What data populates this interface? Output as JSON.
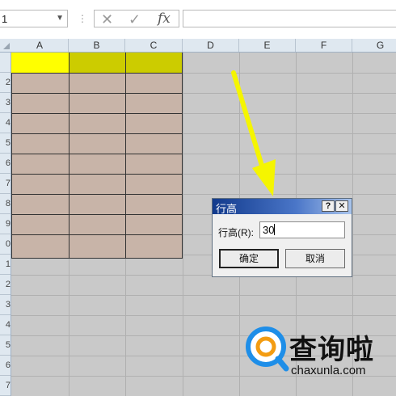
{
  "formula_bar": {
    "name_box": "1",
    "separator": "⋮",
    "cancel_icon": "✕",
    "enter_icon": "✓",
    "fx_label": "fx",
    "formula_value": ""
  },
  "columns": [
    "A",
    "B",
    "C",
    "D",
    "E",
    "F",
    "G"
  ],
  "rows": [
    "",
    "2",
    "3",
    "4",
    "5",
    "6",
    "7",
    "8",
    "9",
    "0",
    "1",
    "2",
    "3",
    "4",
    "5",
    "6",
    "7"
  ],
  "dialog": {
    "title": "行高",
    "help_label": "?",
    "close_label": "✕",
    "field_label": "行高(R):",
    "field_value": "30",
    "ok_label": "确定",
    "cancel_label": "取消"
  },
  "colors": {
    "header_row_a": "#ffff00",
    "header_row_bc": "#cccc00",
    "body_cells": "#c8b4a8",
    "arrow": "#f5f500",
    "sheet_background": "#c9c9c9"
  },
  "watermark": {
    "brand": "查询啦",
    "url": "chaxunla.com",
    "icon": "magnifier-logo"
  }
}
